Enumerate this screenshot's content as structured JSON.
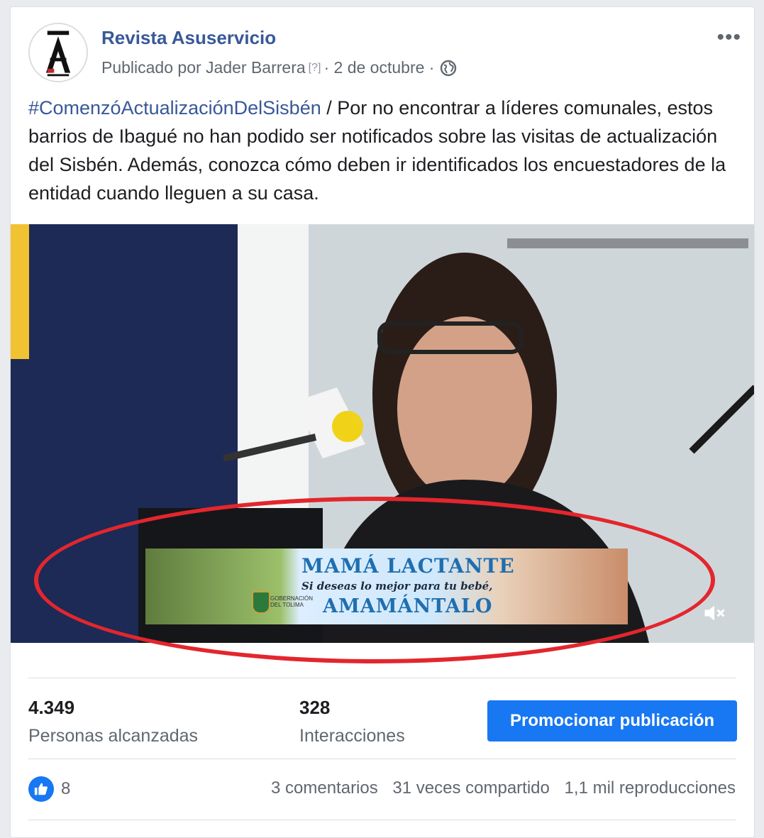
{
  "post": {
    "page_name": "Revista Asuservicio",
    "published_by": "Publicado por Jader Barrera",
    "help_marker": "[?]",
    "date": "· 2 de octubre ·",
    "hashtag": "#ComenzóActualizaciónDelSisbén",
    "body": " / Por no encontrar a líderes comunales, estos barrios de Ibagué no han podido ser notificados sobre las visitas de actualización del Sisbén. Además, conozca cómo deben ir identificados los encuestadores de la entidad cuando lleguen a su casa."
  },
  "video": {
    "banner_title": "MAMÁ LACTANTE",
    "banner_subtitle": "Si deseas lo mejor para tu bebé,",
    "banner_cta": "AMAMÁNTALO",
    "banner_org": "GOBERNACIÓN DEL TOLIMA",
    "annotation_color": "#e3262d"
  },
  "stats": {
    "reach_value": "4.349",
    "reach_label": "Personas alcanzadas",
    "interactions_value": "328",
    "interactions_label": "Interacciones",
    "promote_button": "Promocionar publicación"
  },
  "engagement": {
    "likes": "8",
    "comments": "3 comentarios",
    "shares": "31 veces compartido",
    "views": "1,1 mil reproducciones"
  },
  "icons": {
    "more": "more-options-icon",
    "audience": "globe-icon",
    "like": "like-icon",
    "mute": "muted-speaker-icon"
  },
  "colors": {
    "link": "#385898",
    "brand": "#1877f2"
  }
}
